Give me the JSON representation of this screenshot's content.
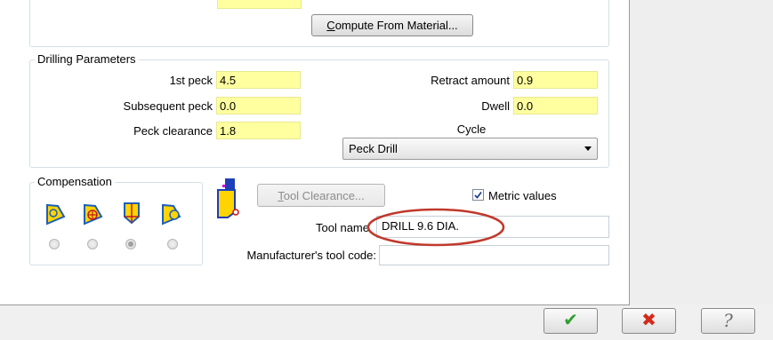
{
  "buttons": {
    "compute_prefix": "C",
    "compute_rest": "ompute From Material...",
    "tool_clearance_prefix": "T",
    "tool_clearance_rest": "ool Clearance..."
  },
  "drilling": {
    "title": "Drilling Parameters",
    "first_peck_label": "1st peck",
    "first_peck_value": "4.5",
    "subsequent_peck_label": "Subsequent peck",
    "subsequent_peck_value": "0.0",
    "peck_clearance_label": "Peck clearance",
    "peck_clearance_value": "1.8",
    "retract_label": "Retract amount",
    "retract_value": "0.9",
    "dwell_label": "Dwell",
    "dwell_value": "0.0",
    "cycle_label": "Cycle",
    "cycle_value": "Peck Drill"
  },
  "compensation": {
    "title": "Compensation",
    "icons": [
      "comp-left-icon",
      "comp-center-icon",
      "comp-tip-icon",
      "comp-right-icon"
    ],
    "selected_index": 2
  },
  "tool": {
    "metric_label": "Metric values",
    "metric_checked": true,
    "tool_name_label": "Tool name",
    "tool_name_value": "DRILL 9.6 DIA.",
    "mfr_label": "Manufacturer's tool code:",
    "mfr_value": ""
  },
  "footer": {
    "ok_glyph": "✔",
    "cancel_glyph": "✖",
    "help_glyph": "?"
  },
  "colors": {
    "yellow_field": "#ffffa0",
    "ok_green": "#2e9e2e",
    "cancel_red": "#d42a1a",
    "highlight_oval": "#c0392b"
  }
}
